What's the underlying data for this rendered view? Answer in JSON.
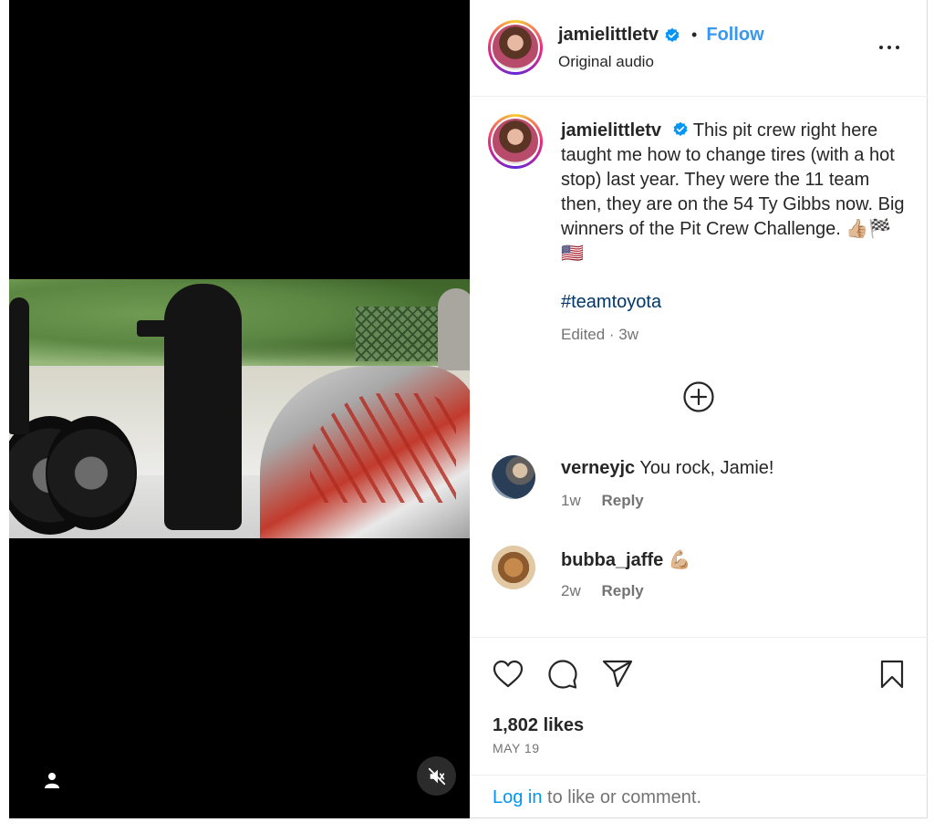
{
  "post": {
    "author": "jamielittletv",
    "follow_label": "Follow",
    "separator": "•",
    "audio": "Original audio"
  },
  "caption": {
    "author": "jamielittletv",
    "text": "This pit crew right here taught me how to change tires (with a hot stop) last year. They were the 11 team then, they are on the 54 Ty Gibbs now. Big winners of the Pit Crew Challenge. 👍🏼🏁🇺🇸",
    "hashtag": "#teamtoyota",
    "edited": "Edited · 3w"
  },
  "comments": [
    {
      "user": "verneyjc",
      "text": "You rock, Jamie!",
      "age": "1w",
      "reply_label": "Reply"
    },
    {
      "user": "bubba_jaffe",
      "text": "💪🏼",
      "age": "2w",
      "reply_label": "Reply"
    }
  ],
  "stats": {
    "likes": "1,802 likes",
    "date": "MAY 19"
  },
  "login": {
    "link": "Log in",
    "rest": " to like or comment."
  },
  "colors": {
    "accent": "#3897f0",
    "hashtag": "#00376b",
    "verified": "#0095f6"
  },
  "icons": [
    "verified-badge-icon",
    "more-options-icon",
    "add-comment-icon",
    "like-heart-icon",
    "comment-bubble-icon",
    "share-icon",
    "save-bookmark-icon",
    "user-tag-icon",
    "muted-audio-icon"
  ]
}
